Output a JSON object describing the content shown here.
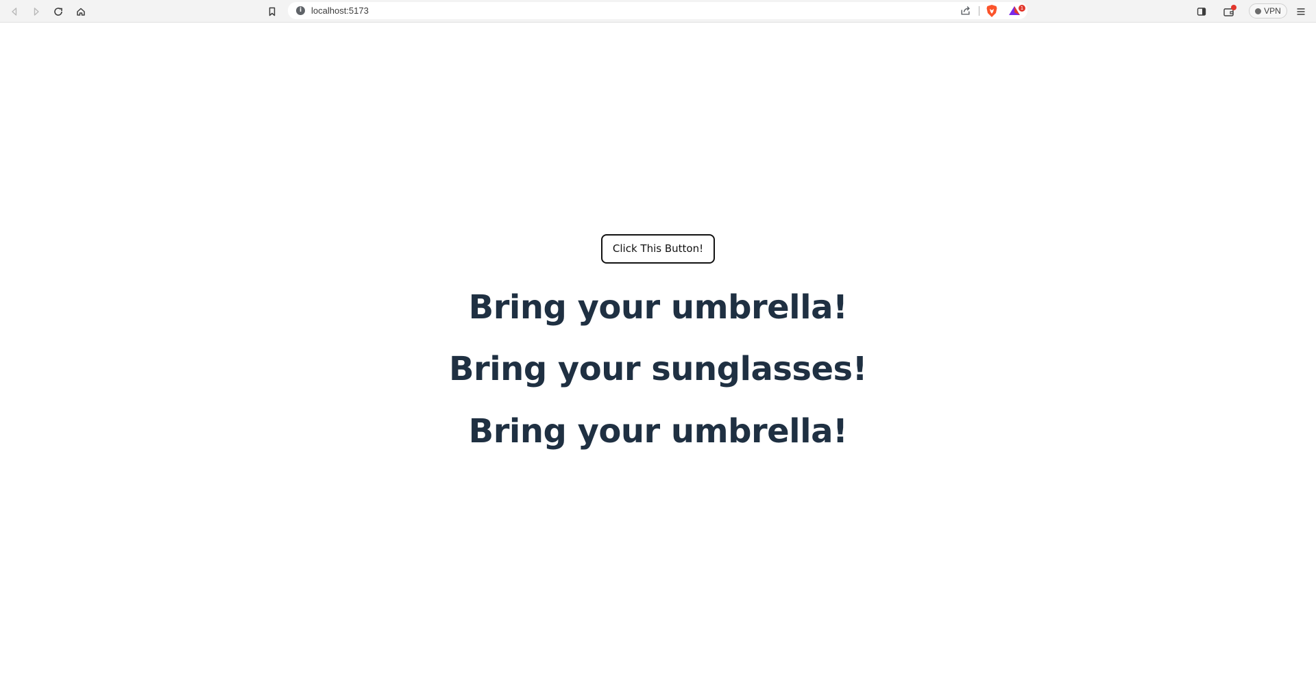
{
  "browser": {
    "url": "localhost:5173",
    "info_glyph": "i",
    "rewards_count": "1",
    "vpn_label": "VPN",
    "icons": [
      "back-icon",
      "forward-icon",
      "reload-icon",
      "home-icon",
      "bookmark-icon",
      "info-icon",
      "share-icon",
      "brave-shields-icon",
      "brave-rewards-icon",
      "sidebar-icon",
      "wallet-icon",
      "vpn-icon",
      "menu-icon"
    ]
  },
  "page": {
    "button_label": "Click This Button!",
    "messages": [
      "Bring your umbrella!",
      "Bring your sunglasses!",
      "Bring your umbrella!"
    ]
  },
  "colors": {
    "heading_text": "#1f3042",
    "button_border": "#111111",
    "brave_orange": "#fb542b",
    "badge_red": "#e2372c"
  }
}
